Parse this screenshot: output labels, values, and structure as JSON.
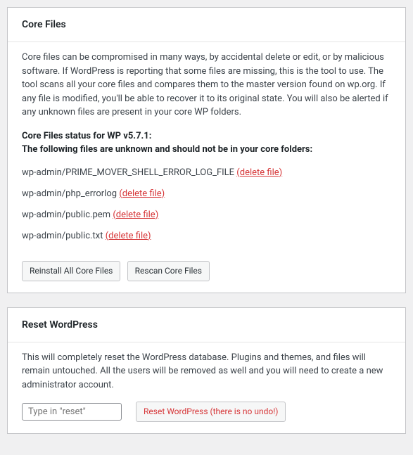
{
  "coreFiles": {
    "title": "Core Files",
    "description": "Core files can be compromised in many ways, by accidental delete or edit, or by malicious software. If WordPress is reporting that some files are missing, this is the tool to use. The tool scans all your core files and compares them to the master version found on wp.org. If any file is modified, you'll be able to recover it to its original state. You will also be alerted if any unknown files are present in your core WP folders.",
    "statusLine1": "Core Files status for WP v5.7.1:",
    "statusLine2": "The following files are unknown and should not be in your core folders:",
    "files": [
      {
        "path": "wp-admin/PRIME_MOVER_SHELL_ERROR_LOG_FILE",
        "action": "(delete file)"
      },
      {
        "path": "wp-admin/php_errorlog",
        "action": "(delete file)"
      },
      {
        "path": "wp-admin/public.pem",
        "action": "(delete file)"
      },
      {
        "path": "wp-admin/public.txt",
        "action": "(delete file)"
      }
    ],
    "reinstallBtn": "Reinstall All Core Files",
    "rescanBtn": "Rescan Core Files"
  },
  "reset": {
    "title": "Reset WordPress",
    "description": "This will completely reset the WordPress database. Plugins and themes, and files will remain untouched. All the users will be removed as well and you will need to create a new administrator account.",
    "placeholder": "Type in \"reset\"",
    "buttonLabel": "Reset WordPress (there is no undo!)"
  }
}
